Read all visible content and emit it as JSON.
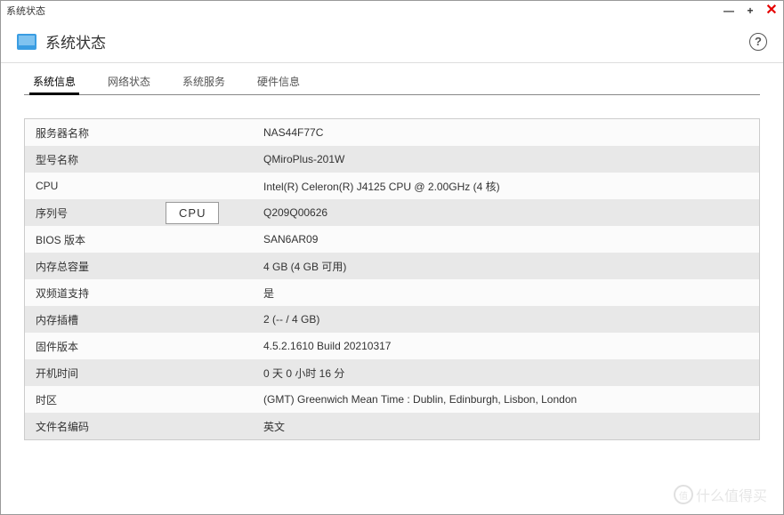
{
  "window": {
    "title": "系统状态"
  },
  "header": {
    "title": "系统状态",
    "help": "?",
    "icon": "monitor-icon"
  },
  "win_controls": {
    "min": "—",
    "max": "+",
    "close": "✕"
  },
  "tabs": [
    {
      "label": "系统信息",
      "active": true
    },
    {
      "label": "网络状态",
      "active": false
    },
    {
      "label": "系统服务",
      "active": false
    },
    {
      "label": "硬件信息",
      "active": false
    }
  ],
  "rows": [
    {
      "label": "服务器名称",
      "value": "NAS44F77C"
    },
    {
      "label": "型号名称",
      "value": "QMiroPlus-201W"
    },
    {
      "label": "CPU",
      "value": "Intel(R) Celeron(R) J4125 CPU @ 2.00GHz (4 核)"
    },
    {
      "label": "序列号",
      "value": "Q209Q00626",
      "badge": "CPU"
    },
    {
      "label": "BIOS 版本",
      "value": "SAN6AR09"
    },
    {
      "label": "内存总容量",
      "value": "4 GB (4 GB 可用)"
    },
    {
      "label": "双频道支持",
      "value": "是"
    },
    {
      "label": "内存插槽",
      "value": "2 (-- / 4 GB)"
    },
    {
      "label": "固件版本",
      "value": "4.5.2.1610 Build 20210317"
    },
    {
      "label": "开机时间",
      "value": "0 天 0 小时 16 分"
    },
    {
      "label": "时区",
      "value": "(GMT) Greenwich Mean Time : Dublin, Edinburgh, Lisbon, London"
    },
    {
      "label": "文件名编码",
      "value": "英文"
    }
  ],
  "watermark": {
    "text": "什么值得买",
    "sub": "值"
  }
}
